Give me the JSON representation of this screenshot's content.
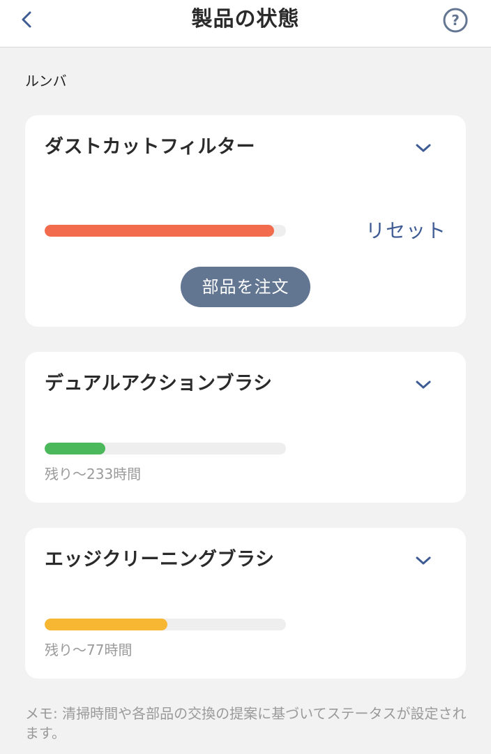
{
  "header": {
    "title": "製品の状態",
    "back_icon": "chevron-left-icon",
    "help_icon": "question-circle-icon"
  },
  "section": {
    "label": "ルンバ"
  },
  "parts": [
    {
      "title": "ダストカットフィルター",
      "progress": 0.95,
      "color": "#f26b4d",
      "reset_label": "リセット",
      "order_label": "部品を注文"
    },
    {
      "title": "デュアルアクションブラシ",
      "progress": 0.25,
      "color": "#4cb85c",
      "remaining": "残り〜233時間"
    },
    {
      "title": "エッジクリーニングブラシ",
      "progress": 0.51,
      "color": "#f7b733",
      "remaining": "残り〜77時間"
    }
  ],
  "memo": "メモ: 清掃時間や各部品の交換の提案に基づいてステータスが設定されます。",
  "colors": {
    "accent": "#3e5c93",
    "button": "#627591",
    "background": "#f2f2f2"
  }
}
